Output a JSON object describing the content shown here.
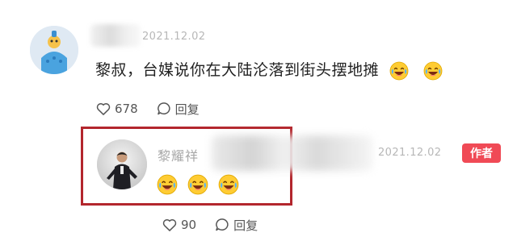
{
  "comment": {
    "date": "2021.12.02",
    "text": "黎叔，台媒说你在大陆沦落到街头摆地摊",
    "emojis": [
      "laugh-cry-emoji",
      "laugh-cry-emoji"
    ],
    "likes": "678",
    "reply_label": "回复"
  },
  "reply": {
    "author": "黎耀祥",
    "date": "2021.12.02",
    "author_badge": "作者",
    "emojis": [
      "laugh-cry-emoji",
      "laugh-cry-emoji",
      "laugh-cry-emoji"
    ],
    "likes": "90",
    "reply_label": "回复"
  },
  "colors": {
    "highlight_border": "#b3262d",
    "badge_bg": "#f04a56",
    "date_text": "#b7b7b7"
  }
}
